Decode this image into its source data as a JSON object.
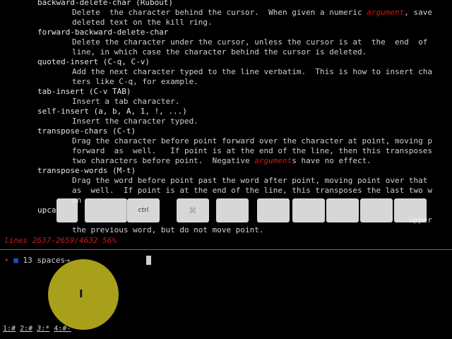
{
  "man_entries": [
    {
      "type": "head",
      "text": "backward-delete-char (Rubout)"
    },
    {
      "type": "body",
      "parts": [
        {
          "t": "Delete  the character behind the cursor.  When given a numeric "
        },
        {
          "t": "argument",
          "em": true
        },
        {
          "t": ", save"
        }
      ]
    },
    {
      "type": "body",
      "parts": [
        {
          "t": "deleted text on the kill ring."
        }
      ]
    },
    {
      "type": "head",
      "text": "forward-backward-delete-char"
    },
    {
      "type": "body",
      "parts": [
        {
          "t": "Delete the character under the cursor, unless the cursor is at  the  end  of"
        }
      ]
    },
    {
      "type": "body",
      "parts": [
        {
          "t": "line, in which case the character behind the cursor is deleted."
        }
      ]
    },
    {
      "type": "head",
      "text": "quoted-insert (C-q, C-v)"
    },
    {
      "type": "body",
      "parts": [
        {
          "t": "Add the next character typed to the line verbatim.  This is how to insert cha"
        }
      ]
    },
    {
      "type": "body",
      "parts": [
        {
          "t": "ters like C-q, for example."
        }
      ]
    },
    {
      "type": "head",
      "text": "tab-insert (C-v TAB)"
    },
    {
      "type": "body",
      "parts": [
        {
          "t": "Insert a tab character."
        }
      ]
    },
    {
      "type": "head",
      "text": "self-insert (a, b, A, 1, !, ...)"
    },
    {
      "type": "body",
      "parts": [
        {
          "t": "Insert the character typed."
        }
      ]
    },
    {
      "type": "head",
      "text": "transpose-chars (C-t)"
    },
    {
      "type": "body",
      "parts": [
        {
          "t": "Drag the character before point forward over the character at point, moving p"
        }
      ]
    },
    {
      "type": "body",
      "parts": [
        {
          "t": "forward  as  well.   If point is at the end of the line, then this transposes"
        }
      ]
    },
    {
      "type": "body",
      "parts": [
        {
          "t": "two characters before point.  Negative "
        },
        {
          "t": "argument",
          "em": true
        },
        {
          "t": "s have no effect."
        }
      ]
    },
    {
      "type": "head",
      "text": "transpose-words (M-t)"
    },
    {
      "type": "body",
      "parts": [
        {
          "t": "Drag the word before point past the word after point, moving point over that"
        }
      ]
    },
    {
      "type": "body",
      "parts": [
        {
          "t": "as  well.  If point is at the end of the line, this transposes the last two w"
        }
      ]
    },
    {
      "type": "body",
      "parts": [
        {
          "t": "on"
        }
      ]
    },
    {
      "type": "head",
      "text": "upca"
    },
    {
      "type": "body",
      "parts": [
        {
          "t": "                                                                        upper"
        }
      ]
    },
    {
      "type": "body",
      "parts": [
        {
          "t": "the previous word, but do not move point."
        }
      ]
    }
  ],
  "status_line": "lines 2637-2659/4632 56%",
  "prompt": {
    "marker": "•",
    "square": "■",
    "text": " 13 spaces→"
  },
  "overlay_keys": [
    {
      "label": ""
    },
    {
      "label": ""
    },
    {
      "label": "ctrl"
    },
    {
      "label": "⌘"
    },
    {
      "label": ""
    },
    {
      "label": ""
    },
    {
      "label": ""
    },
    {
      "label": ""
    },
    {
      "label": ""
    },
    {
      "label": ""
    }
  ],
  "tmux_tabs": [
    "1:#",
    "2:#",
    "3:*",
    "4:#-"
  ],
  "icons": {
    "mouse": "i-beam-cursor-icon"
  }
}
